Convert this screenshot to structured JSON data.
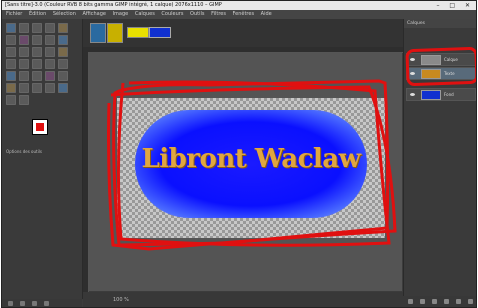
{
  "window": {
    "title": "[Sans titre]-3.0 (Couleur RVB 8 bits gamma GIMP intégré, 1 calque) 2076x1110 – GIMP"
  },
  "menubar": {
    "items": [
      "Fichier",
      "Édition",
      "Sélection",
      "Affichage",
      "Image",
      "Calques",
      "Couleurs",
      "Outils",
      "Filtres",
      "Fenêtres",
      "Aide"
    ]
  },
  "canvas": {
    "text": "Libront Waclaw",
    "text_color": "#e0a640",
    "fill_color": "#0a10ff"
  },
  "layers": {
    "header": "Calques",
    "rows": [
      {
        "name": "Calque"
      },
      {
        "name": "Texte"
      },
      {
        "name": "Fond"
      }
    ]
  },
  "toolopts": {
    "title": "Options des outils"
  },
  "status": {
    "zoom": "100 %"
  },
  "icons": {
    "tools": "tool-icons",
    "eye": "eye-icon"
  },
  "colors": {
    "annotation": "#e01010",
    "fg": "#ffffff",
    "bg": "#e01010"
  }
}
